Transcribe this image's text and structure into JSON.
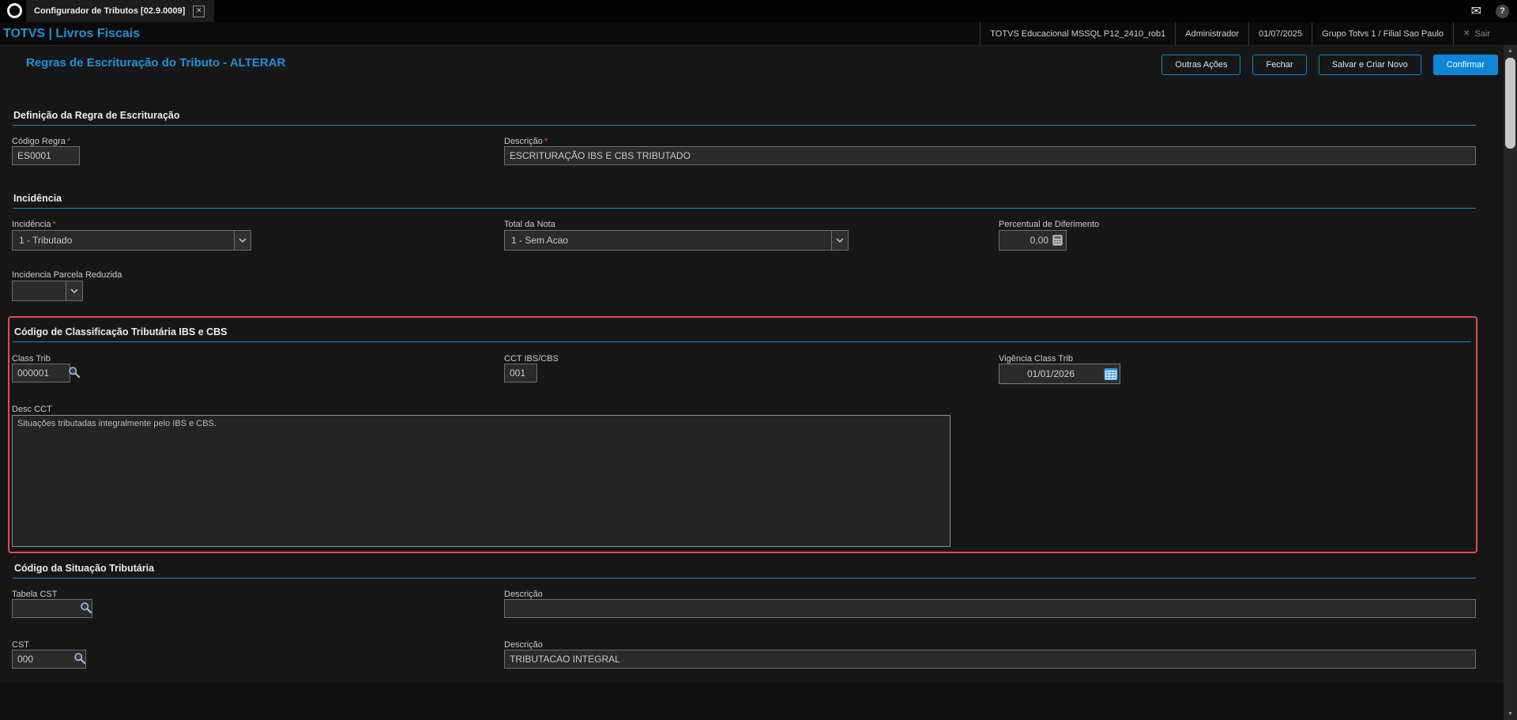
{
  "window": {
    "tab": "Configurador de Tributos [02.9.0009]",
    "close_icon": "✕",
    "mail_icon": "✉",
    "help_icon": "?"
  },
  "appbar": {
    "brand": "TOTVS | Livros Fiscais",
    "environment": "TOTVS Educacional MSSQL P12_2410_rob1",
    "user": "Administrador",
    "date": "01/07/2025",
    "branch": "Grupo Totvs 1 / Filial Sao Paulo",
    "exit": "Sair",
    "exit_icon": "✕"
  },
  "toolbar": {
    "title": "Regras de Escrituração do Tributo - ALTERAR",
    "other_actions": "Outras Ações",
    "close": "Fechar",
    "save_and_new": "Salvar e Criar Novo",
    "confirm": "Confirmar"
  },
  "ui": {
    "required_marker": "*",
    "scroll_up": "▲",
    "scroll_down": "▼",
    "accent_blue": "#1287d2",
    "highlight_red": "#e24c4c"
  },
  "definicao": {
    "title": "Definição da Regra de Escrituração",
    "codigo_regra_label": "Código Regra",
    "codigo_regra_value": "ES0001",
    "descricao_label": "Descrição",
    "descricao_value": "ESCRITURAÇÃO IBS E CBS TRIBUTADO"
  },
  "incidencia": {
    "title": "Incidência",
    "incidencia_label": "Incidência",
    "incidencia_value": "1 - Tributado",
    "total_nota_label": "Total da Nota",
    "total_nota_value": "1 - Sem Acao",
    "diferimento_label": "Percentual de Diferimento",
    "diferimento_value": "0,00",
    "parcela_label": "Incidencia Parcela Reduzida",
    "parcela_value": ""
  },
  "cct": {
    "title": "Código de Classificação Tributária IBS e CBS",
    "class_trib_label": "Class Trib",
    "class_trib_value": "000001",
    "cct_label": "CCT IBS/CBS",
    "cct_value": "001",
    "vigencia_label": "Vigência Class Trib",
    "vigencia_value": "01/01/2026",
    "desc_cct_label": "Desc CCT",
    "desc_cct_value": "Situações tributadas integralmente pelo IBS e CBS."
  },
  "cst": {
    "title": "Código da Situação Tributária",
    "tabela_label": "Tabela CST",
    "tabela_value": "",
    "tabela_desc_label": "Descrição",
    "tabela_desc_value": "",
    "cst_label": "CST",
    "cst_value": "000",
    "cst_desc_label": "Descrição",
    "cst_desc_value": "TRIBUTACAO INTEGRAL"
  }
}
